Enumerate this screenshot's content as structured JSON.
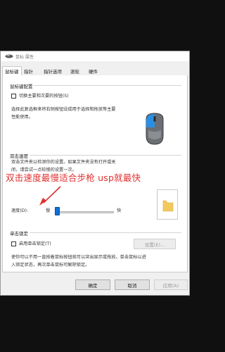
{
  "window": {
    "title": "鼠标 属性"
  },
  "tabs": [
    {
      "label": "鼠标键",
      "active": true
    },
    {
      "label": "指针"
    },
    {
      "label": "指针选项"
    },
    {
      "label": "滚轮"
    },
    {
      "label": "硬件"
    }
  ],
  "buttons_config": {
    "title": "鼠标键配置",
    "checkbox_label": "切换主要和次要的按钮(S)",
    "desc": [
      "选择此复选框来将右侧按钮设成用于选择和拖放等主要",
      "性能使用。"
    ]
  },
  "double_click": {
    "title": "双击速度",
    "desc": [
      "双击文件夹以检测你的设置。如果文件夹没有打开或关",
      "闭，请尝试一点较慢的设置一次。"
    ],
    "speed_label": "速度(D):",
    "slow": "慢",
    "fast": "快",
    "speed_value": 0.05
  },
  "click_lock": {
    "title": "单击锁定",
    "checkbox_label": "启用单击锁定(T)",
    "settings_button": "设置(E)...",
    "desc": [
      "使你可以不用一直按着鼠标按钮就可以突出显示或拖放。单击鼠标以进",
      "入锁定状态，再次单击鼠标可解除锁定。"
    ]
  },
  "footer": {
    "ok": "确定",
    "cancel": "取消",
    "apply": "应用(A)"
  },
  "annotation": {
    "text": "双击速度最慢适合步枪 usp就最快",
    "color": "#e03030"
  }
}
